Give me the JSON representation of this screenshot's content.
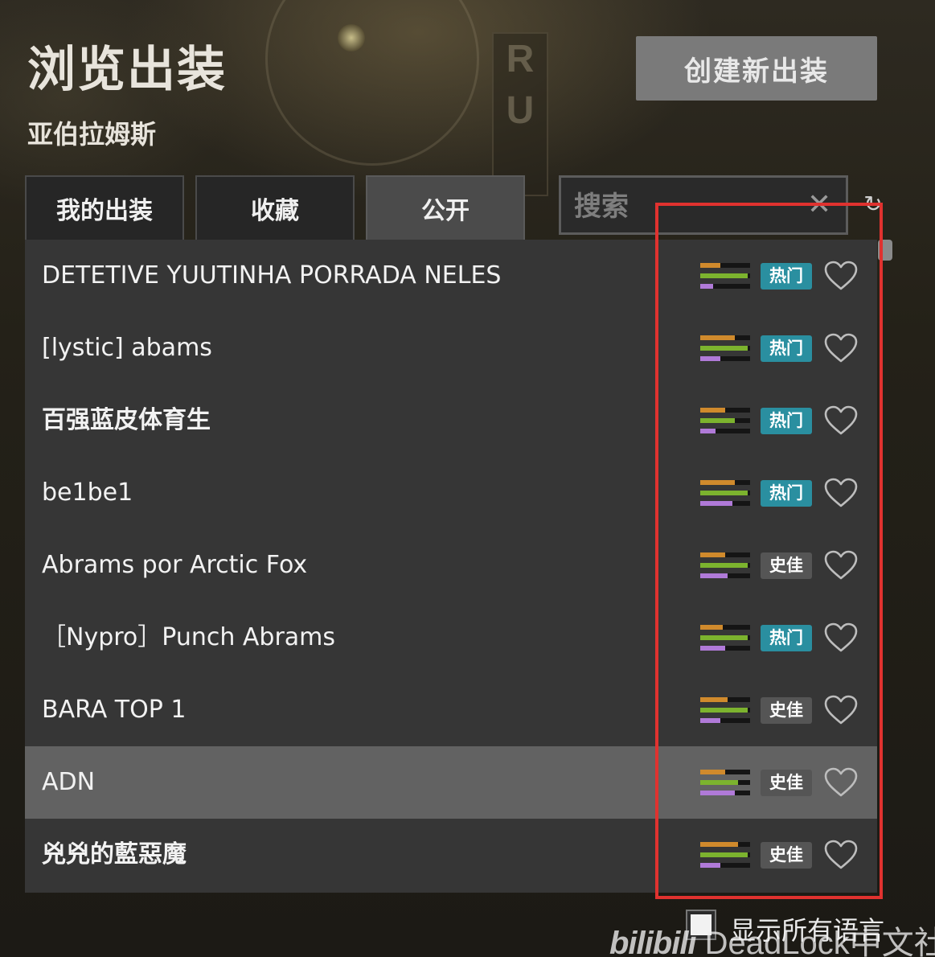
{
  "header": {
    "title": "浏览出装",
    "hero_name": "亚伯拉姆斯",
    "create_button_label": "创建新出装"
  },
  "tabs": [
    {
      "label": "我的出装",
      "active": false
    },
    {
      "label": "收藏",
      "active": false
    },
    {
      "label": "公开",
      "active": true
    }
  ],
  "search": {
    "placeholder": "搜索",
    "value": "",
    "clear_icon": "close-icon",
    "refresh_icon": "refresh-icon"
  },
  "colors": {
    "bar_orange": "#d08a2c",
    "bar_green": "#7cb32e",
    "bar_purple": "#b07ad8",
    "badge_hot": "#2a8fa0",
    "badge_best": "#555555",
    "annotation": "#e0322f"
  },
  "builds": [
    {
      "name": "DETETIVE YUUTINHA PORRADA NELES",
      "badge": "热门",
      "badge_type": "hot",
      "stats": [
        0.4,
        0.95,
        0.25
      ],
      "selected": false
    },
    {
      "name": "[lystic] abams",
      "badge": "热门",
      "badge_type": "hot",
      "stats": [
        0.7,
        0.95,
        0.4
      ],
      "selected": false
    },
    {
      "name": "百强蓝皮体育生",
      "badge": "热门",
      "badge_type": "hot",
      "stats": [
        0.5,
        0.7,
        0.3
      ],
      "selected": false
    },
    {
      "name": "be1be1",
      "badge": "热门",
      "badge_type": "hot",
      "stats": [
        0.7,
        0.95,
        0.65
      ],
      "selected": false
    },
    {
      "name": "Abrams por Arctic Fox",
      "badge": "史佳",
      "badge_type": "best",
      "stats": [
        0.5,
        0.95,
        0.55
      ],
      "selected": false
    },
    {
      "name": "［Nypro］Punch Abrams",
      "badge": "热门",
      "badge_type": "hot",
      "stats": [
        0.45,
        0.95,
        0.5
      ],
      "selected": false
    },
    {
      "name": "BARA TOP 1",
      "badge": "史佳",
      "badge_type": "best",
      "stats": [
        0.55,
        0.95,
        0.4
      ],
      "selected": false
    },
    {
      "name": "ADN",
      "badge": "史佳",
      "badge_type": "best",
      "stats": [
        0.5,
        0.75,
        0.7
      ],
      "selected": true
    },
    {
      "name": "兇兇的藍惡魔",
      "badge": "史佳",
      "badge_type": "best",
      "stats": [
        0.75,
        0.95,
        0.4
      ],
      "selected": false
    }
  ],
  "footer": {
    "show_all_languages_label": "显示所有语言",
    "show_all_languages_checked": false
  },
  "watermark": {
    "logo": "bilibili",
    "text": "DeadLock中文社区"
  }
}
